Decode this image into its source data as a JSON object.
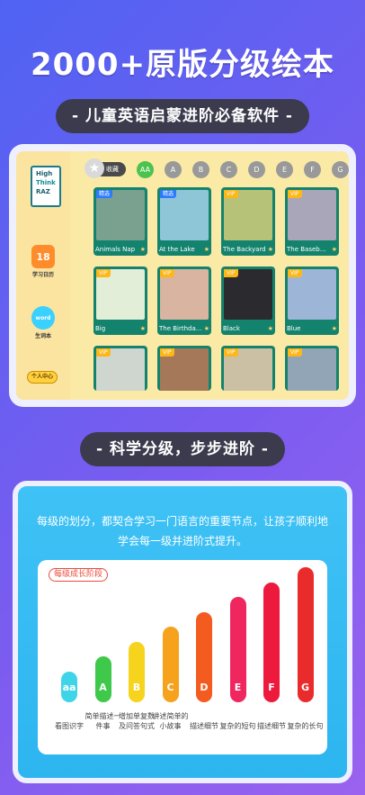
{
  "headline": "2000+原版分级绘本",
  "subtitle1": "- 儿童英语启蒙进阶必备软件 -",
  "subtitle2": "- 科学分级，步步进阶 -",
  "app": {
    "logo_lines": [
      "High",
      "Think",
      "RAZ"
    ],
    "rail": {
      "calendar_label": "学习日历",
      "calendar_number": "18",
      "wordbook_label": "生词本",
      "wordbook_icon_text": "word",
      "me_label": "个人中心"
    },
    "favorites_label": "收藏",
    "levels": [
      "AA",
      "A",
      "B",
      "C",
      "D",
      "E",
      "F",
      "G"
    ],
    "active_level": "AA",
    "books": [
      {
        "title": "Animals Nap",
        "badge": "精选",
        "badge_type": "listen",
        "thumb": "#7aa08f"
      },
      {
        "title": "At the Lake",
        "badge": "精选",
        "badge_type": "listen",
        "thumb": "#8ec6d8"
      },
      {
        "title": "The Backyard",
        "badge": "VIP",
        "badge_type": "vip",
        "thumb": "#b7c279"
      },
      {
        "title": "The Baseball...",
        "badge": "VIP",
        "badge_type": "vip",
        "thumb": "#a9a6b9"
      },
      {
        "title": "Big",
        "badge": "VIP",
        "badge_type": "vip",
        "thumb": "#e2eed7"
      },
      {
        "title": "The Birthda...",
        "badge": "VIP",
        "badge_type": "vip",
        "thumb": "#d9b4a1"
      },
      {
        "title": "Black",
        "badge": "VIP",
        "badge_type": "vip",
        "thumb": "#2b2b2f"
      },
      {
        "title": "Blue",
        "badge": "VIP",
        "badge_type": "vip",
        "thumb": "#9db6d8"
      },
      {
        "title": "",
        "badge": "VIP",
        "badge_type": "vip",
        "thumb": "#cfd6cf"
      },
      {
        "title": "",
        "badge": "VIP",
        "badge_type": "vip",
        "thumb": "#a6785a"
      },
      {
        "title": "",
        "badge": "VIP",
        "badge_type": "vip",
        "thumb": "#cbbfa4"
      },
      {
        "title": "",
        "badge": "VIP",
        "badge_type": "vip",
        "thumb": "#91a5b6"
      }
    ]
  },
  "description": "每级的划分，都契合学习一门语言的重要节点，让孩子顺利地学会每一级并进阶式提升。",
  "chart_tag": "每级成长阶段",
  "chart_data": {
    "type": "bar",
    "title": "",
    "categories": [
      "aa",
      "A",
      "B",
      "C",
      "D",
      "E",
      "F",
      "G"
    ],
    "series": [
      {
        "values": [
          1,
          2,
          3,
          4,
          5,
          6,
          7,
          8
        ]
      }
    ],
    "category_descriptions": [
      "看图识字",
      "简单描述一件事",
      "增加单复数及问答句式",
      "讲述简单的小故事",
      "描述细节",
      "复杂的短句",
      "描述细节",
      "复杂的长句"
    ],
    "colors": [
      "#3fd4e8",
      "#3fc94a",
      "#f6d31c",
      "#f6a21c",
      "#f45b1e",
      "#f0275e",
      "#ee1a3d",
      "#ea2b2b"
    ],
    "ylim": [
      0,
      8
    ]
  }
}
